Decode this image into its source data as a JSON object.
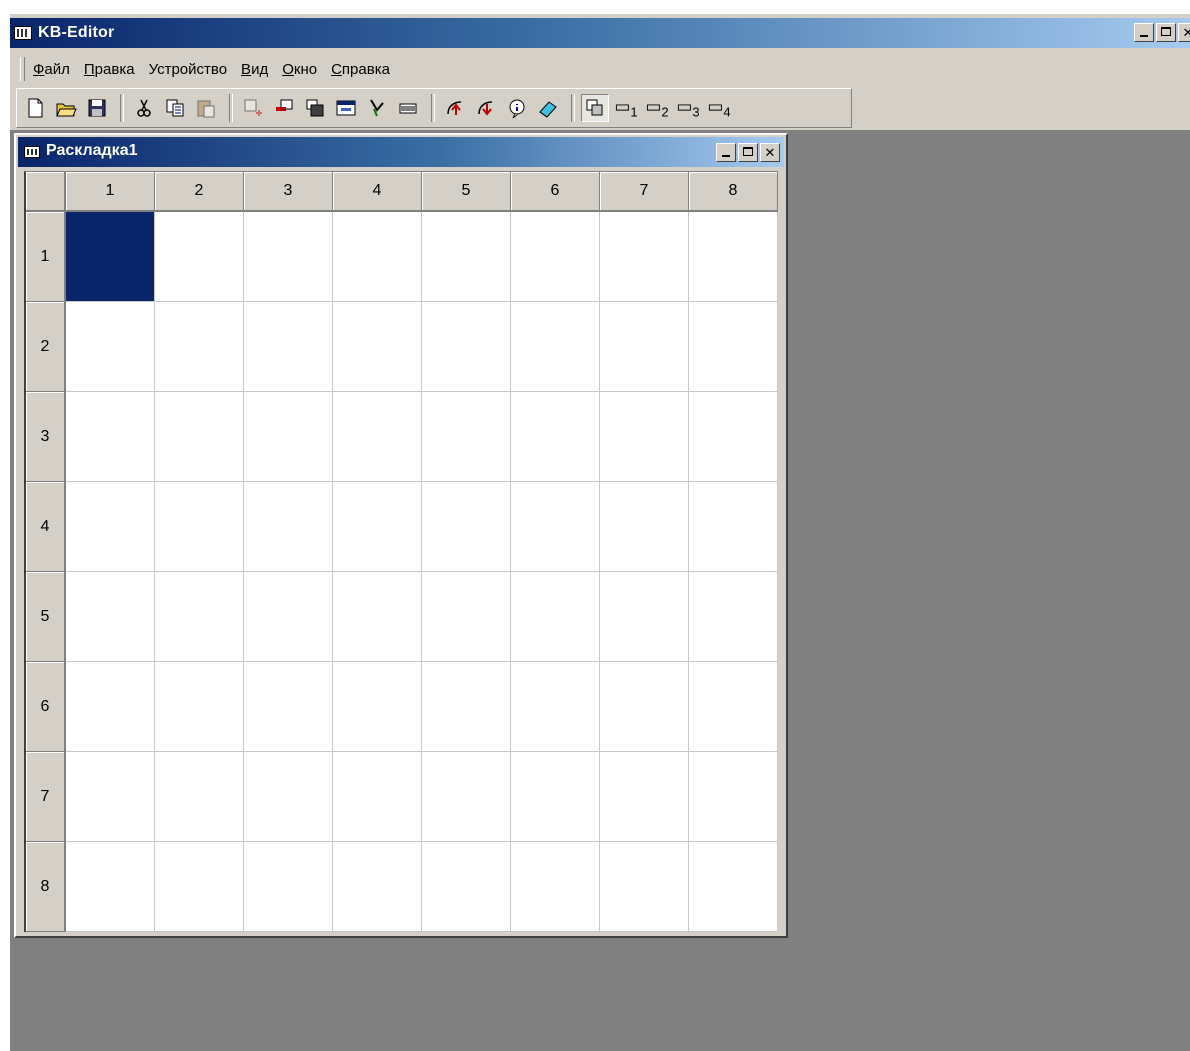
{
  "app": {
    "title": "KB-Editor",
    "menu": [
      {
        "label": "Файл",
        "accel": "Ф",
        "rest": "айл"
      },
      {
        "label": "Правка",
        "accel": "П",
        "rest": "равка"
      },
      {
        "label": "Устройство",
        "accel": "",
        "rest": "Устройство"
      },
      {
        "label": "Вид",
        "accel": "В",
        "rest": "ид"
      },
      {
        "label": "Окно",
        "accel": "О",
        "rest": "кно"
      },
      {
        "label": "Справка",
        "accel": "С",
        "rest": "правка"
      }
    ],
    "toolbar": {
      "layer_buttons": [
        "1",
        "2",
        "3",
        "4"
      ]
    }
  },
  "child_window": {
    "title": "Раскладка1",
    "columns": [
      "1",
      "2",
      "3",
      "4",
      "5",
      "6",
      "7",
      "8"
    ],
    "rows": [
      "1",
      "2",
      "3",
      "4",
      "5",
      "6",
      "7",
      "8"
    ],
    "selected_cell": {
      "row": "1",
      "column": "1"
    }
  },
  "colors": {
    "selection": "#0a246a",
    "title_bar_active": "#0a246a",
    "mdi_background": "#808080"
  }
}
